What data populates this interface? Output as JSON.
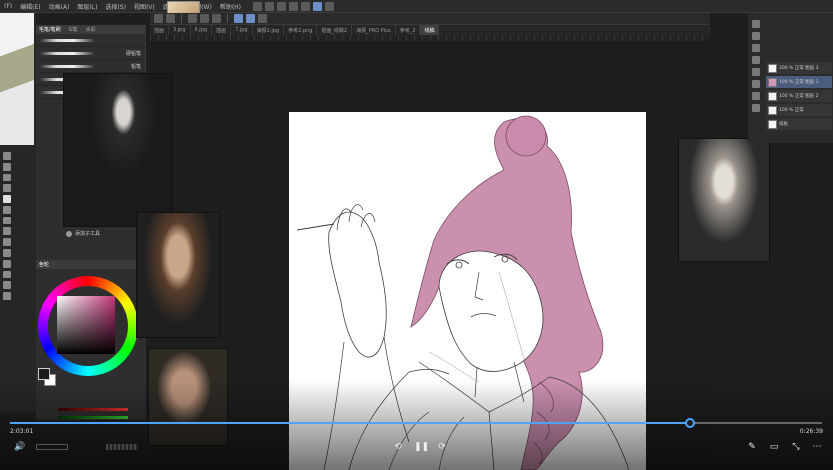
{
  "menubar": {
    "items": [
      "(F)",
      "编辑(E)",
      "动画(A)",
      "图层(L)",
      "选择(S)",
      "视图(V)",
      "滤镜(I)",
      "窗口(W)",
      "帮助(H)"
    ]
  },
  "tabs": [
    {
      "label": "插画",
      "active": false
    },
    {
      "label": "3.jpg",
      "active": false
    },
    {
      "label": "5.jpg",
      "active": false
    },
    {
      "label": "插画",
      "active": false
    },
    {
      "label": "7.jpg",
      "active": false
    },
    {
      "label": "海报2.jpg",
      "active": false
    },
    {
      "label": "参考2.png",
      "active": false
    },
    {
      "label": "插画_线稿2",
      "active": false
    },
    {
      "label": "海报_PRO Plus",
      "active": false
    },
    {
      "label": "参考_2",
      "active": false
    },
    {
      "label": "线稿",
      "active": true
    }
  ],
  "brush_panel": {
    "tabs": [
      "毛笔/笔刷",
      "G笔",
      "水彩"
    ],
    "items": [
      {
        "label": ""
      },
      {
        "label": "硬铅笔"
      },
      {
        "label": "铅笔"
      },
      {
        "label": ""
      },
      {
        "label": ""
      },
      {
        "label": ""
      },
      {
        "label": ""
      },
      {
        "label": ""
      }
    ]
  },
  "ref_caption": "添加子工具",
  "color_panel": {
    "title": "色轮"
  },
  "layers": [
    {
      "label": "200 % 正常 图层 3",
      "selected": false
    },
    {
      "label": "100 % 正常 图层 1",
      "selected": true
    },
    {
      "label": "100 % 正常 图层 2",
      "selected": false
    },
    {
      "label": "100 % 正常",
      "selected": false
    },
    {
      "label": "纸张",
      "selected": false
    }
  ],
  "video": {
    "current_time": "2:03:01",
    "duration": "0:26:39",
    "progress": 0.838
  },
  "colors": {
    "hair": "#c98aab",
    "line": "#3a3a3a",
    "progress": "#4da3ff"
  }
}
